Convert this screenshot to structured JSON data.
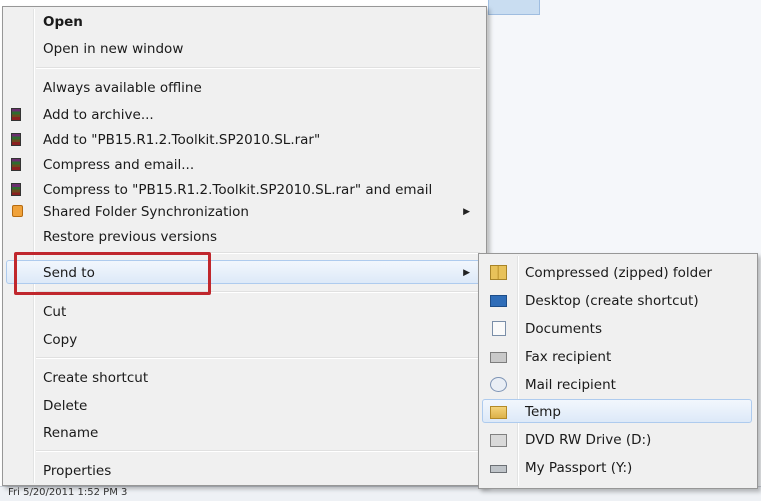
{
  "context_menu": {
    "items": [
      {
        "label": "Open"
      },
      {
        "label": "Open in new window"
      },
      {
        "label": "Always available offline"
      },
      {
        "label": "Add to archive..."
      },
      {
        "label": "Add to \"PB15.R1.2.Toolkit.SP2010.SL.rar\""
      },
      {
        "label": "Compress and email..."
      },
      {
        "label": "Compress to \"PB15.R1.2.Toolkit.SP2010.SL.rar\" and email"
      },
      {
        "label": "Shared Folder Synchronization"
      },
      {
        "label": "Restore previous versions"
      },
      {
        "label": "Send to"
      },
      {
        "label": "Cut"
      },
      {
        "label": "Copy"
      },
      {
        "label": "Create shortcut"
      },
      {
        "label": "Delete"
      },
      {
        "label": "Rename"
      },
      {
        "label": "Properties"
      }
    ],
    "submenu_arrow": "▶"
  },
  "send_to_menu": {
    "items": [
      {
        "label": "Compressed (zipped) folder",
        "icon": "zip-folder-icon"
      },
      {
        "label": "Desktop (create shortcut)",
        "icon": "desktop-icon"
      },
      {
        "label": "Documents",
        "icon": "documents-icon"
      },
      {
        "label": "Fax recipient",
        "icon": "fax-icon"
      },
      {
        "label": "Mail recipient",
        "icon": "mail-icon"
      },
      {
        "label": "Temp",
        "icon": "folder-icon"
      },
      {
        "label": "DVD RW Drive (D:)",
        "icon": "dvd-drive-icon"
      },
      {
        "label": "My Passport (Y:)",
        "icon": "usb-drive-icon"
      }
    ]
  },
  "status_bar": {
    "text": "Fri 5/20/2011 1:52 PM   3"
  },
  "colors": {
    "highlight_box": "#c0272d",
    "menu_bg": "#f0f0f0",
    "hover_border": "#aecbee"
  }
}
